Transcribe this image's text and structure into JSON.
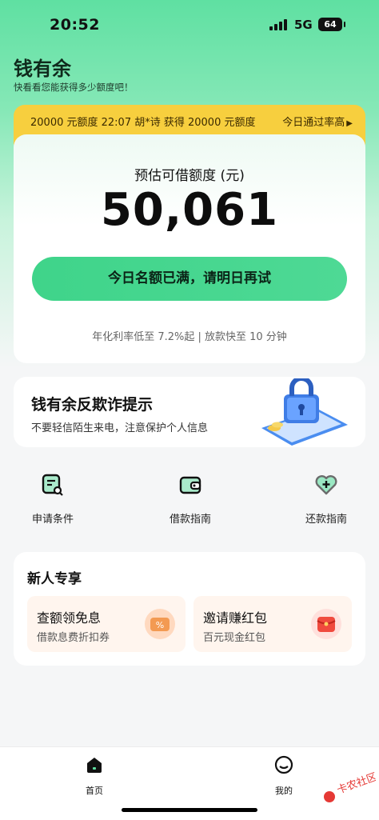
{
  "status": {
    "time": "20:52",
    "network": "5G",
    "battery": "64"
  },
  "app": {
    "title": "钱有余",
    "subtitle": "快看看您能获得多少额度吧！"
  },
  "ticker": {
    "text": "20000 元额度   22:07  胡*诗 获得 20000 元额度",
    "right": "今日通过率高"
  },
  "loan": {
    "label": "预估可借额度 (元)",
    "amount": "50,061",
    "cta": "今日名额已满，请明日再试",
    "rate_text": "年化利率低至 7.2%起  |  放款快至 10 分钟"
  },
  "fraud": {
    "title": "钱有余反欺诈提示",
    "subtitle": "不要轻信陌生来电，注意保护个人信息"
  },
  "quick_actions": [
    {
      "label": "申请条件",
      "icon": "document-search-icon"
    },
    {
      "label": "借款指南",
      "icon": "wallet-icon"
    },
    {
      "label": "还款指南",
      "icon": "heart-plus-icon"
    }
  ],
  "promo": {
    "title": "新人专享",
    "items": [
      {
        "title": "查额领免息",
        "subtitle": "借款息费折扣券",
        "icon": "discount-coupon-icon"
      },
      {
        "title": "邀请赚红包",
        "subtitle": "百元现金红包",
        "icon": "red-envelope-icon"
      }
    ]
  },
  "tabbar": {
    "tabs": [
      {
        "label": "首页",
        "icon": "home-icon"
      },
      {
        "label": "我的",
        "icon": "profile-icon"
      }
    ]
  },
  "watermark": {
    "text": "卡农社区"
  },
  "colors": {
    "accent": "#3fd48a",
    "ticker_bg": "#f7cf3e"
  }
}
